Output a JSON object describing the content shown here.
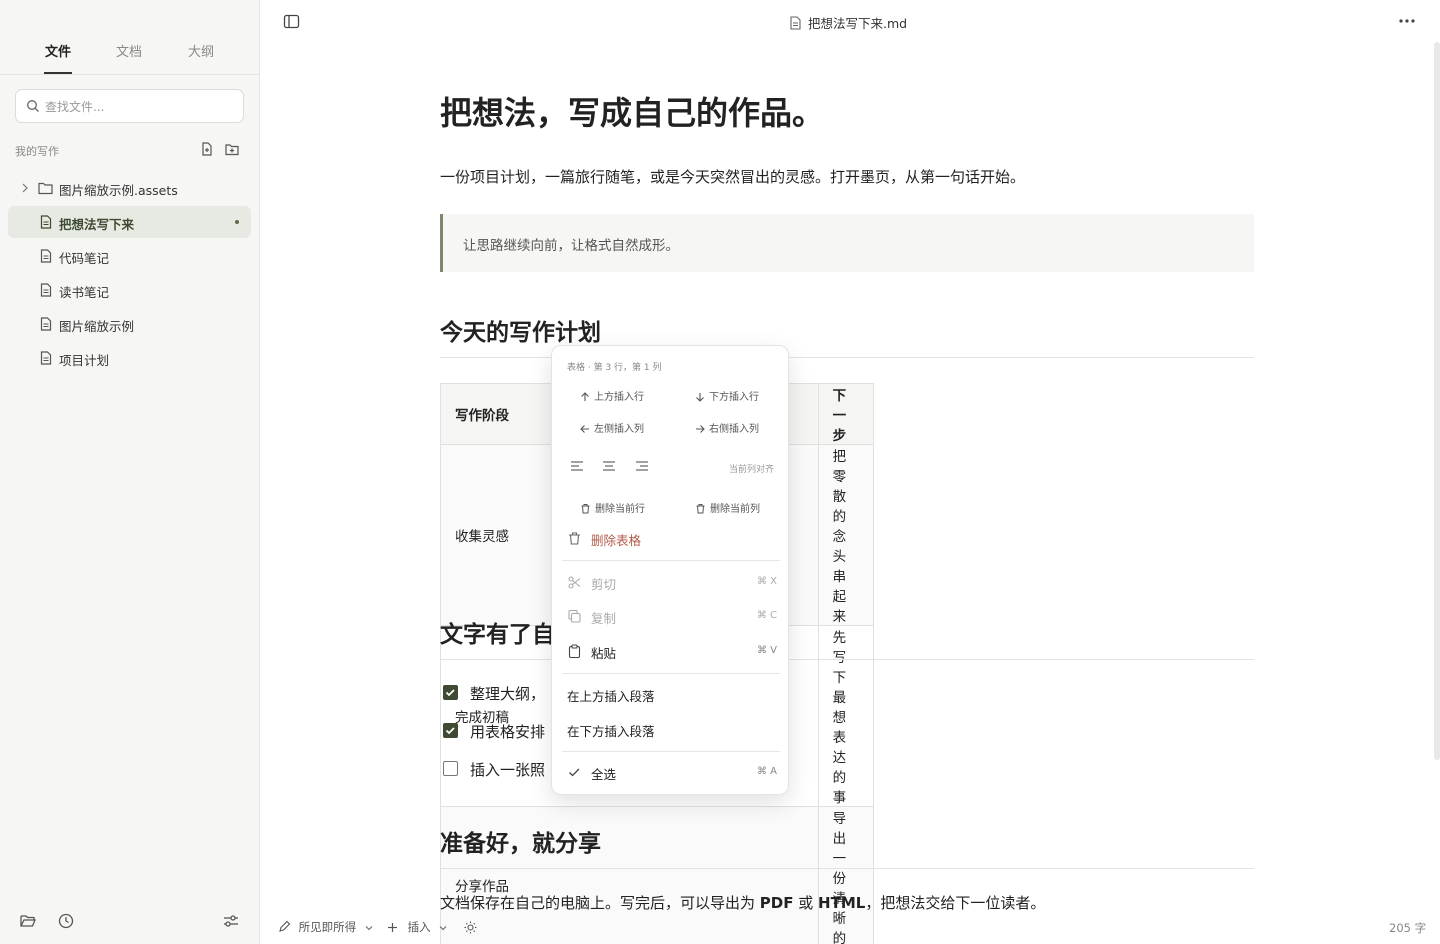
{
  "sidebar": {
    "tabs": [
      "文件",
      "文档",
      "大纲"
    ],
    "search_placeholder": "查找文件...",
    "section_title": "我的写作",
    "items": [
      {
        "label": "图片缩放示例.assets",
        "type": "folder"
      },
      {
        "label": "把想法写下来",
        "type": "file",
        "active": true
      },
      {
        "label": "代码笔记",
        "type": "file"
      },
      {
        "label": "读书笔记",
        "type": "file"
      },
      {
        "label": "图片缩放示例",
        "type": "file"
      },
      {
        "label": "项目计划",
        "type": "file"
      }
    ]
  },
  "header": {
    "title": "把想法写下来.md"
  },
  "document": {
    "h1": "把想法，写成自己的作品。",
    "intro": "一份项目计划，一篇旅行随笔，或是今天突然冒出的灵感。打开墨页，从第一句话开始。",
    "quote": "让思路继续向前，让格式自然成形。",
    "h2_plan": "今天的写作计划",
    "table": {
      "headers": [
        "写作阶段",
        "",
        "下一步"
      ],
      "rows": [
        [
          "收集灵感",
          "",
          "把零散的念头串起来"
        ],
        [
          "完成初稿",
          "",
          "先写下最想表达的事"
        ],
        [
          "分享作品",
          "",
          "导出一份清晰的 PDF"
        ]
      ]
    },
    "h2_text": "文字有了自",
    "tasks": [
      {
        "text": "整理大纲，",
        "checked": true
      },
      {
        "text": "用表格安排",
        "checked": true
      },
      {
        "text": "插入一张照",
        "checked": false
      }
    ],
    "h2_share": "准备好，就分享",
    "outro_a": "文档保存在自己的电脑上。写完后，可以导出为 ",
    "outro_b": "PDF",
    "outro_c": " 或 ",
    "outro_d": "HTML",
    "outro_e": "，把想法交给下一位读者。"
  },
  "bottom": {
    "mode": "所见即所得",
    "insert": "插入",
    "word_count": "205 字"
  },
  "menu": {
    "header": "表格 · 第 3 行，第 1 列",
    "insert_row_above": "上方插入行",
    "insert_row_below": "下方插入行",
    "insert_col_left": "左侧插入列",
    "insert_col_right": "右侧插入列",
    "align_label": "当前列对齐",
    "delete_row": "删除当前行",
    "delete_col": "删除当前列",
    "delete_table": "删除表格",
    "cut": "剪切",
    "cut_shortcut": "⌘ X",
    "copy": "复制",
    "copy_shortcut": "⌘ C",
    "paste": "粘贴",
    "paste_shortcut": "⌘ V",
    "insert_para_above": "在上方插入段落",
    "insert_para_below": "在下方插入段落",
    "select_all": "全选",
    "select_all_shortcut": "⌘ A"
  }
}
